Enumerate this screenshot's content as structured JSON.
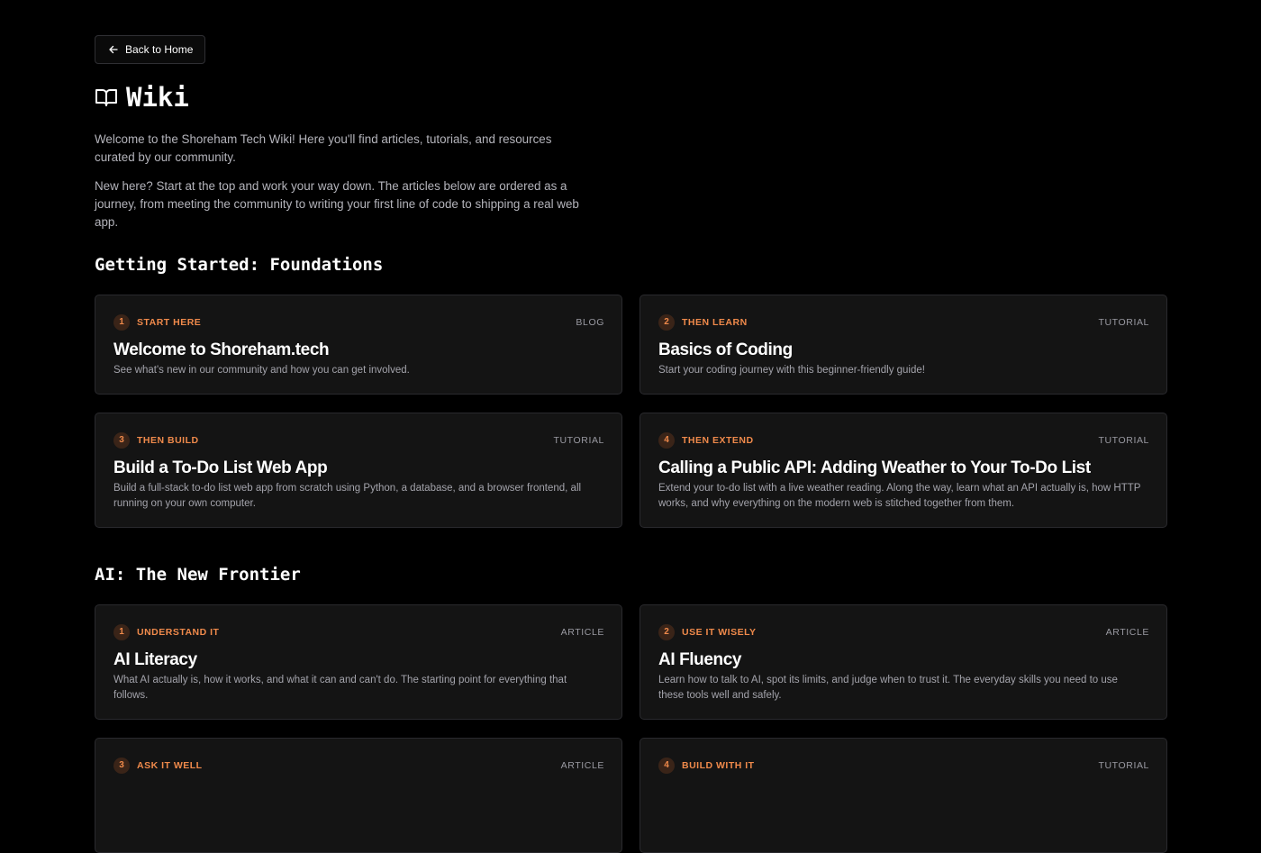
{
  "nav": {
    "back_label": "Back to Home"
  },
  "header": {
    "title": "Wiki",
    "icon": "book-open-icon"
  },
  "intro": {
    "p1": "Welcome to the Shoreham Tech Wiki! Here you'll find articles, tutorials, and resources curated by our community.",
    "p2": "New here? Start at the top and work your way down. The articles below are ordered as a journey, from meeting the community to writing your first line of code to shipping a real web app."
  },
  "colors": {
    "accent": "#f08a4b",
    "background": "#000000",
    "card": "#141414"
  },
  "sections": [
    {
      "title": "Getting Started: Foundations",
      "cards": [
        {
          "step": "1",
          "label": "START HERE",
          "kind": "BLOG",
          "title": "Welcome to Shoreham.tech",
          "description": "See what's new in our community and how you can get involved."
        },
        {
          "step": "2",
          "label": "THEN LEARN",
          "kind": "TUTORIAL",
          "title": "Basics of Coding",
          "description": "Start your coding journey with this beginner-friendly guide!"
        },
        {
          "step": "3",
          "label": "THEN BUILD",
          "kind": "TUTORIAL",
          "title": "Build a To-Do List Web App",
          "description": "Build a full-stack to-do list web app from scratch using Python, a database, and a browser frontend, all running on your own computer."
        },
        {
          "step": "4",
          "label": "THEN EXTEND",
          "kind": "TUTORIAL",
          "title": "Calling a Public API: Adding Weather to Your To-Do List",
          "description": "Extend your to-do list with a live weather reading. Along the way, learn what an API actually is, how HTTP works, and why everything on the modern web is stitched together from them."
        }
      ]
    },
    {
      "title": "AI: The New Frontier",
      "cards": [
        {
          "step": "1",
          "label": "UNDERSTAND IT",
          "kind": "ARTICLE",
          "title": "AI Literacy",
          "description": "What AI actually is, how it works, and what it can and can't do. The starting point for everything that follows."
        },
        {
          "step": "2",
          "label": "USE IT WISELY",
          "kind": "ARTICLE",
          "title": "AI Fluency",
          "description": "Learn how to talk to AI, spot its limits, and judge when to trust it. The everyday skills you need to use these tools well and safely."
        },
        {
          "step": "3",
          "label": "ASK IT WELL",
          "kind": "ARTICLE",
          "title": "",
          "description": ""
        },
        {
          "step": "4",
          "label": "BUILD WITH IT",
          "kind": "TUTORIAL",
          "title": "",
          "description": ""
        }
      ]
    }
  ]
}
